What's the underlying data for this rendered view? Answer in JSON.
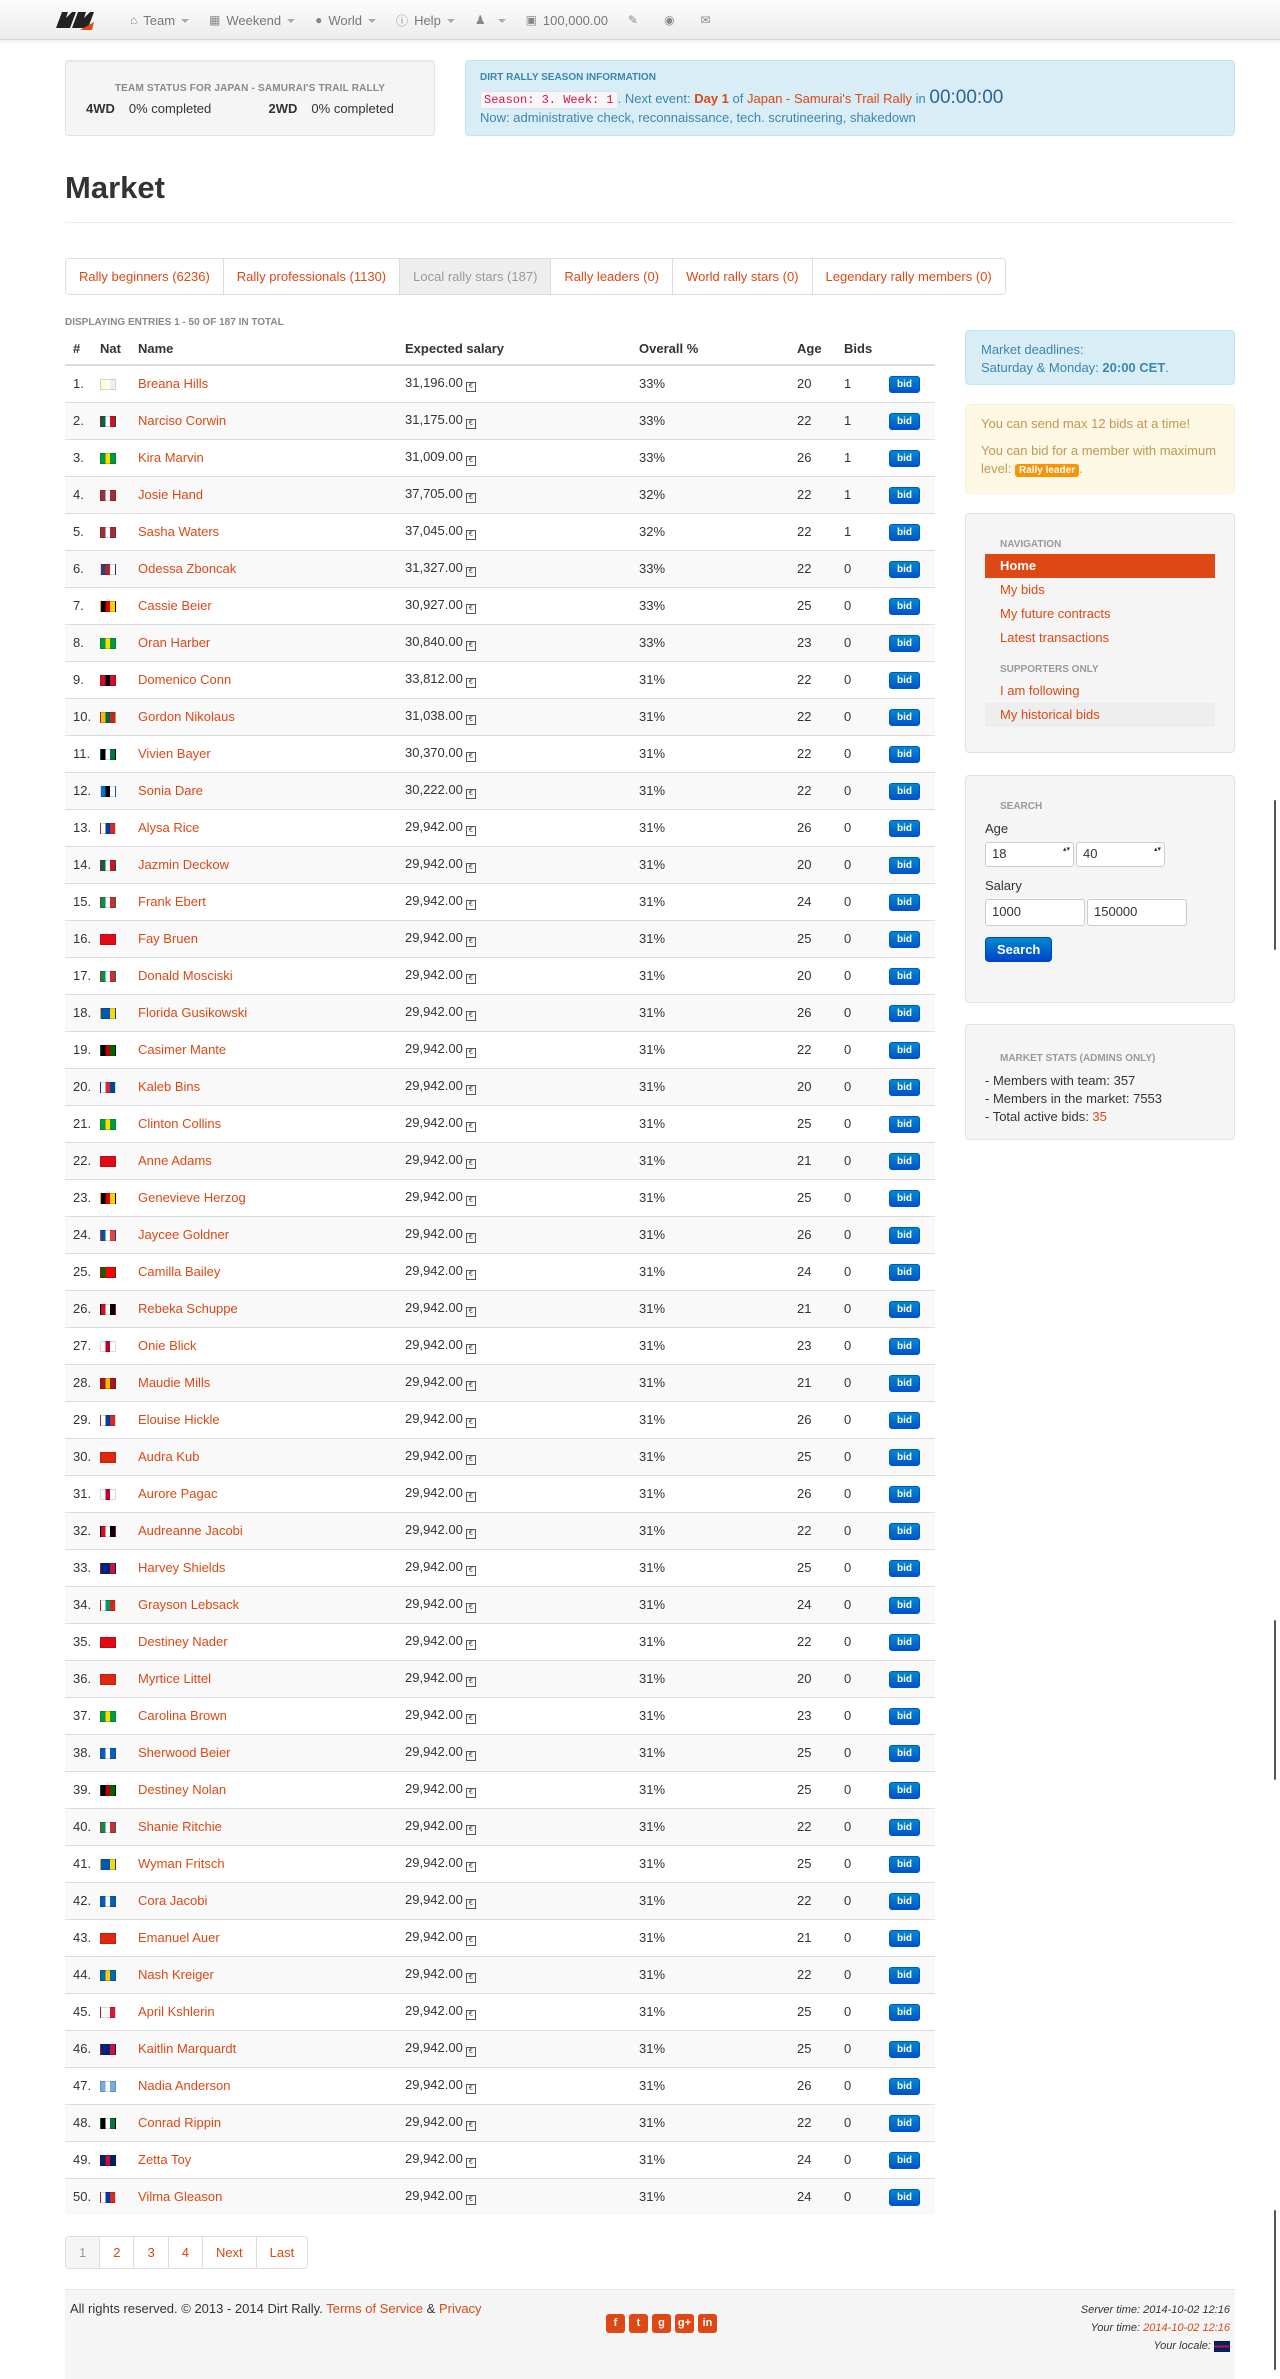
{
  "navbar": {
    "items": [
      {
        "label": "Team",
        "icon": "home-icon",
        "caret": true
      },
      {
        "label": "Weekend",
        "icon": "calendar-icon",
        "caret": true
      },
      {
        "label": "World",
        "icon": "globe-icon",
        "caret": true
      },
      {
        "label": "Help",
        "icon": "info-icon",
        "caret": true
      },
      {
        "label": "",
        "icon": "user-icon",
        "caret": true
      },
      {
        "label": "100,000.00",
        "icon": "currency-icon",
        "caret": false
      }
    ],
    "extra_icons": [
      "edit-icon",
      "world-icon",
      "envelope-icon"
    ]
  },
  "team_status": {
    "title": "Team status for Japan - Samurai's Trail Rally",
    "rows": [
      {
        "label": "4WD",
        "value": "0% completed"
      },
      {
        "label": "2WD",
        "value": "0% completed"
      }
    ]
  },
  "season_info": {
    "title": "Dirt Rally season information",
    "season_code": "Season: 3. Week: 1",
    "next_event_prefix": ". Next event: ",
    "day": "Day 1",
    "of_text": " of ",
    "event": "Japan - Samurai's Trail Rally",
    "in_text": " in ",
    "timer": "00:00:00",
    "now": "Now: administrative check, reconnaissance, tech. scrutineering, shakedown"
  },
  "page_title": "Market",
  "tabs": [
    {
      "label": "Rally beginners (6236)",
      "active": false
    },
    {
      "label": "Rally professionals (1130)",
      "active": false
    },
    {
      "label": "Local rally stars (187)",
      "active": true
    },
    {
      "label": "Rally leaders (0)",
      "active": false
    },
    {
      "label": "World rally stars (0)",
      "active": false
    },
    {
      "label": "Legendary rally members (0)",
      "active": false
    }
  ],
  "displaying": "Displaying entries 1 - 50 of 187 in total",
  "table": {
    "headers": [
      "#",
      "Nat",
      "Name",
      "Expected salary",
      "Overall %",
      "Age",
      "Bids"
    ],
    "bid_label": "bid",
    "rows": [
      {
        "n": "1.",
        "flag": [
          "#ffffcc",
          "#fff",
          "#eee"
        ],
        "name": "Breana Hills",
        "salary": "31,196.00",
        "overall": "33%",
        "age": "20",
        "bids": "1"
      },
      {
        "n": "2.",
        "flag": [
          "#006847",
          "#fff",
          "#ce1126"
        ],
        "name": "Narciso Corwin",
        "salary": "31,175.00",
        "overall": "33%",
        "age": "22",
        "bids": "1"
      },
      {
        "n": "3.",
        "flag": [
          "#009c3b",
          "#ffdf00",
          "#009c3b"
        ],
        "name": "Kira Marvin",
        "salary": "31,009.00",
        "overall": "33%",
        "age": "26",
        "bids": "1"
      },
      {
        "n": "4.",
        "flag": [
          "#9e3039",
          "#fff",
          "#9e3039"
        ],
        "name": "Josie Hand",
        "salary": "37,705.00",
        "overall": "32%",
        "age": "22",
        "bids": "1"
      },
      {
        "n": "5.",
        "flag": [
          "#9e3039",
          "#fff",
          "#9e3039"
        ],
        "name": "Sasha Waters",
        "salary": "37,045.00",
        "overall": "32%",
        "age": "22",
        "bids": "1"
      },
      {
        "n": "6.",
        "flag": [
          "#3c3b6e",
          "#b22234",
          "#fff"
        ],
        "name": "Odessa Zboncak",
        "salary": "31,327.00",
        "overall": "33%",
        "age": "22",
        "bids": "0"
      },
      {
        "n": "7.",
        "flag": [
          "#000",
          "#dd0000",
          "#ffce00"
        ],
        "name": "Cassie Beier",
        "salary": "30,927.00",
        "overall": "33%",
        "age": "25",
        "bids": "0"
      },
      {
        "n": "8.",
        "flag": [
          "#009c3b",
          "#ffdf00",
          "#009c3b"
        ],
        "name": "Oran Harber",
        "salary": "30,840.00",
        "overall": "33%",
        "age": "23",
        "bids": "0"
      },
      {
        "n": "9.",
        "flag": [
          "#ce1126",
          "#000",
          "#ce1126"
        ],
        "name": "Domenico Conn",
        "salary": "33,812.00",
        "overall": "31%",
        "age": "22",
        "bids": "0"
      },
      {
        "n": "10.",
        "flag": [
          "#fdb913",
          "#006a44",
          "#c1272d"
        ],
        "name": "Gordon Nikolaus",
        "salary": "31,038.00",
        "overall": "31%",
        "age": "22",
        "bids": "0"
      },
      {
        "n": "11.",
        "flag": [
          "#000",
          "#fff",
          "#007a3d"
        ],
        "name": "Vivien Bayer",
        "salary": "30,370.00",
        "overall": "31%",
        "age": "22",
        "bids": "0"
      },
      {
        "n": "12.",
        "flag": [
          "#0072ce",
          "#000",
          "#fff"
        ],
        "name": "Sonia Dare",
        "salary": "30,222.00",
        "overall": "31%",
        "age": "22",
        "bids": "0"
      },
      {
        "n": "13.",
        "flag": [
          "#fff",
          "#0039a6",
          "#d52b1e"
        ],
        "name": "Alysa Rice",
        "salary": "29,942.00",
        "overall": "31%",
        "age": "26",
        "bids": "0"
      },
      {
        "n": "14.",
        "flag": [
          "#006847",
          "#fff",
          "#ce1126"
        ],
        "name": "Jazmin Deckow",
        "salary": "29,942.00",
        "overall": "31%",
        "age": "20",
        "bids": "0"
      },
      {
        "n": "15.",
        "flag": [
          "#009246",
          "#fff",
          "#ce2b37"
        ],
        "name": "Frank Ebert",
        "salary": "29,942.00",
        "overall": "31%",
        "age": "24",
        "bids": "0"
      },
      {
        "n": "16.",
        "flag": [
          "#e30a17",
          "#e30a17",
          "#e30a17"
        ],
        "name": "Fay Bruen",
        "salary": "29,942.00",
        "overall": "31%",
        "age": "25",
        "bids": "0"
      },
      {
        "n": "17.",
        "flag": [
          "#009246",
          "#fff",
          "#ce2b37"
        ],
        "name": "Donald Mosciski",
        "salary": "29,942.00",
        "overall": "31%",
        "age": "20",
        "bids": "0"
      },
      {
        "n": "18.",
        "flag": [
          "#0057b7",
          "#0057b7",
          "#ffd700"
        ],
        "name": "Florida Gusikowski",
        "salary": "29,942.00",
        "overall": "31%",
        "age": "26",
        "bids": "0"
      },
      {
        "n": "19.",
        "flag": [
          "#000",
          "#bb0000",
          "#006600"
        ],
        "name": "Casimer Mante",
        "salary": "29,942.00",
        "overall": "31%",
        "age": "22",
        "bids": "0"
      },
      {
        "n": "20.",
        "flag": [
          "#fff",
          "#cd2e3a",
          "#0047a0"
        ],
        "name": "Kaleb Bins",
        "salary": "29,942.00",
        "overall": "31%",
        "age": "20",
        "bids": "0"
      },
      {
        "n": "21.",
        "flag": [
          "#009c3b",
          "#ffdf00",
          "#009c3b"
        ],
        "name": "Clinton Collins",
        "salary": "29,942.00",
        "overall": "31%",
        "age": "25",
        "bids": "0"
      },
      {
        "n": "22.",
        "flag": [
          "#e30a17",
          "#e30a17",
          "#e30a17"
        ],
        "name": "Anne Adams",
        "salary": "29,942.00",
        "overall": "31%",
        "age": "21",
        "bids": "0"
      },
      {
        "n": "23.",
        "flag": [
          "#000",
          "#dd0000",
          "#ffce00"
        ],
        "name": "Genevieve Herzog",
        "salary": "29,942.00",
        "overall": "31%",
        "age": "25",
        "bids": "0"
      },
      {
        "n": "24.",
        "flag": [
          "#0055a4",
          "#fff",
          "#ef4135"
        ],
        "name": "Jaycee Goldner",
        "salary": "29,942.00",
        "overall": "31%",
        "age": "26",
        "bids": "0"
      },
      {
        "n": "25.",
        "flag": [
          "#006600",
          "#ff0000",
          "#ff0000"
        ],
        "name": "Camilla Bailey",
        "salary": "29,942.00",
        "overall": "31%",
        "age": "24",
        "bids": "0"
      },
      {
        "n": "26.",
        "flag": [
          "#ce1126",
          "#fff",
          "#000"
        ],
        "name": "Rebeka Schuppe",
        "salary": "29,942.00",
        "overall": "31%",
        "age": "21",
        "bids": "0"
      },
      {
        "n": "27.",
        "flag": [
          "#fff",
          "#bc002d",
          "#fff"
        ],
        "name": "Onie Blick",
        "salary": "29,942.00",
        "overall": "31%",
        "age": "23",
        "bids": "0"
      },
      {
        "n": "28.",
        "flag": [
          "#aa151b",
          "#f1bf00",
          "#aa151b"
        ],
        "name": "Maudie Mills",
        "salary": "29,942.00",
        "overall": "31%",
        "age": "21",
        "bids": "0"
      },
      {
        "n": "29.",
        "flag": [
          "#fff",
          "#0039a6",
          "#d52b1e"
        ],
        "name": "Elouise Hickle",
        "salary": "29,942.00",
        "overall": "31%",
        "age": "26",
        "bids": "0"
      },
      {
        "n": "30.",
        "flag": [
          "#de2910",
          "#de2910",
          "#de2910"
        ],
        "name": "Audra Kub",
        "salary": "29,942.00",
        "overall": "31%",
        "age": "25",
        "bids": "0"
      },
      {
        "n": "31.",
        "flag": [
          "#fff",
          "#bc002d",
          "#fff"
        ],
        "name": "Aurore Pagac",
        "salary": "29,942.00",
        "overall": "31%",
        "age": "26",
        "bids": "0"
      },
      {
        "n": "32.",
        "flag": [
          "#ce1126",
          "#fff",
          "#000"
        ],
        "name": "Audreanne Jacobi",
        "salary": "29,942.00",
        "overall": "31%",
        "age": "22",
        "bids": "0"
      },
      {
        "n": "33.",
        "flag": [
          "#00247d",
          "#00247d",
          "#cf142b"
        ],
        "name": "Harvey Shields",
        "salary": "29,942.00",
        "overall": "31%",
        "age": "25",
        "bids": "0"
      },
      {
        "n": "34.",
        "flag": [
          "#fff",
          "#00966e",
          "#d62612"
        ],
        "name": "Grayson Lebsack",
        "salary": "29,942.00",
        "overall": "31%",
        "age": "24",
        "bids": "0"
      },
      {
        "n": "35.",
        "flag": [
          "#e30a17",
          "#e30a17",
          "#e30a17"
        ],
        "name": "Destiney Nader",
        "salary": "29,942.00",
        "overall": "31%",
        "age": "22",
        "bids": "0"
      },
      {
        "n": "36.",
        "flag": [
          "#de2910",
          "#de2910",
          "#de2910"
        ],
        "name": "Myrtice Littel",
        "salary": "29,942.00",
        "overall": "31%",
        "age": "20",
        "bids": "0"
      },
      {
        "n": "37.",
        "flag": [
          "#009c3b",
          "#ffdf00",
          "#009c3b"
        ],
        "name": "Carolina Brown",
        "salary": "29,942.00",
        "overall": "31%",
        "age": "23",
        "bids": "0"
      },
      {
        "n": "38.",
        "flag": [
          "#0d5eaf",
          "#fff",
          "#0d5eaf"
        ],
        "name": "Sherwood Beier",
        "salary": "29,942.00",
        "overall": "31%",
        "age": "25",
        "bids": "0"
      },
      {
        "n": "39.",
        "flag": [
          "#000",
          "#bb0000",
          "#006600"
        ],
        "name": "Destiney Nolan",
        "salary": "29,942.00",
        "overall": "31%",
        "age": "25",
        "bids": "0"
      },
      {
        "n": "40.",
        "flag": [
          "#009246",
          "#fff",
          "#ce2b37"
        ],
        "name": "Shanie Ritchie",
        "salary": "29,942.00",
        "overall": "31%",
        "age": "22",
        "bids": "0"
      },
      {
        "n": "41.",
        "flag": [
          "#0057b7",
          "#0057b7",
          "#ffd700"
        ],
        "name": "Wyman Fritsch",
        "salary": "29,942.00",
        "overall": "31%",
        "age": "25",
        "bids": "0"
      },
      {
        "n": "42.",
        "flag": [
          "#0d5eaf",
          "#fff",
          "#0d5eaf"
        ],
        "name": "Cora Jacobi",
        "salary": "29,942.00",
        "overall": "31%",
        "age": "22",
        "bids": "0"
      },
      {
        "n": "43.",
        "flag": [
          "#de2910",
          "#de2910",
          "#de2910"
        ],
        "name": "Emanuel Auer",
        "salary": "29,942.00",
        "overall": "31%",
        "age": "21",
        "bids": "0"
      },
      {
        "n": "44.",
        "flag": [
          "#006aa7",
          "#fecc00",
          "#006aa7"
        ],
        "name": "Nash Kreiger",
        "salary": "29,942.00",
        "overall": "31%",
        "age": "22",
        "bids": "0"
      },
      {
        "n": "45.",
        "flag": [
          "#fff",
          "#fff",
          "#dc143c"
        ],
        "name": "April Kshlerin",
        "salary": "29,942.00",
        "overall": "31%",
        "age": "25",
        "bids": "0"
      },
      {
        "n": "46.",
        "flag": [
          "#00247d",
          "#00247d",
          "#cf142b"
        ],
        "name": "Kaitlin Marquardt",
        "salary": "29,942.00",
        "overall": "31%",
        "age": "25",
        "bids": "0"
      },
      {
        "n": "47.",
        "flag": [
          "#74acdf",
          "#fff",
          "#74acdf"
        ],
        "name": "Nadia Anderson",
        "salary": "29,942.00",
        "overall": "31%",
        "age": "26",
        "bids": "0"
      },
      {
        "n": "48.",
        "flag": [
          "#000",
          "#fff",
          "#007a3d"
        ],
        "name": "Conrad Rippin",
        "salary": "29,942.00",
        "overall": "31%",
        "age": "22",
        "bids": "0"
      },
      {
        "n": "49.",
        "flag": [
          "#012169",
          "#c8102e",
          "#012169"
        ],
        "name": "Zetta Toy",
        "salary": "29,942.00",
        "overall": "31%",
        "age": "24",
        "bids": "0"
      },
      {
        "n": "50.",
        "flag": [
          "#fff",
          "#0039a6",
          "#d52b1e"
        ],
        "name": "Vilma Gleason",
        "salary": "29,942.00",
        "overall": "31%",
        "age": "24",
        "bids": "0"
      }
    ]
  },
  "pagination": [
    {
      "label": "1",
      "active": true
    },
    {
      "label": "2",
      "active": false
    },
    {
      "label": "3",
      "active": false
    },
    {
      "label": "4",
      "active": false
    },
    {
      "label": "Next",
      "active": false
    },
    {
      "label": "Last",
      "active": false
    }
  ],
  "sidebar": {
    "deadline": {
      "line1": "Market deadlines:",
      "line2_prefix": "Saturday & Monday: ",
      "line2_time": "20:00 CET",
      "line2_suffix": "."
    },
    "warning": {
      "line1": "You can send max 12 bids at a time!",
      "line2": "You can bid for a member with maximum level: ",
      "badge": "Rally leader",
      "badge_suffix": "."
    },
    "nav": {
      "header": "Navigation",
      "items": [
        {
          "label": "Home",
          "active": true
        },
        {
          "label": "My bids",
          "active": false
        },
        {
          "label": "My future contracts",
          "active": false
        },
        {
          "label": "Latest transactions",
          "active": false
        }
      ],
      "supporters_header": "Supporters only",
      "supporters_items": [
        {
          "label": "I am following",
          "hover": false
        },
        {
          "label": "My historical bids",
          "hover": true
        }
      ]
    },
    "search": {
      "header": "Search",
      "age_label": "Age",
      "age_min": "18",
      "age_max": "40",
      "salary_label": "Salary",
      "salary_min": "1000",
      "salary_max": "150000",
      "button": "Search"
    },
    "stats": {
      "header": "Market stats (admins only)",
      "members_with_team": "- Members with team: 357",
      "members_in_market": "- Members in the market: 7553",
      "total_bids_prefix": "- Total active bids: ",
      "total_bids": "35"
    }
  },
  "footer": {
    "copy_prefix": "All rights reserved. © 2013 - 2014 Dirt Rally. ",
    "terms": "Terms of Service",
    "amp": " & ",
    "privacy": "Privacy",
    "social": [
      "f",
      "t",
      "g",
      "g+",
      "in"
    ],
    "server_time": "Server time: 2014-10-02 12:16",
    "your_time_label": "Your time: ",
    "your_time": "2014-10-02 12:16",
    "locale_label": "Your locale: "
  },
  "colors": {
    "accent": "#dd4814",
    "info_bg": "#d9edf7",
    "warn_bg": "#fcf8e3",
    "button_blue": "#0074cc"
  }
}
